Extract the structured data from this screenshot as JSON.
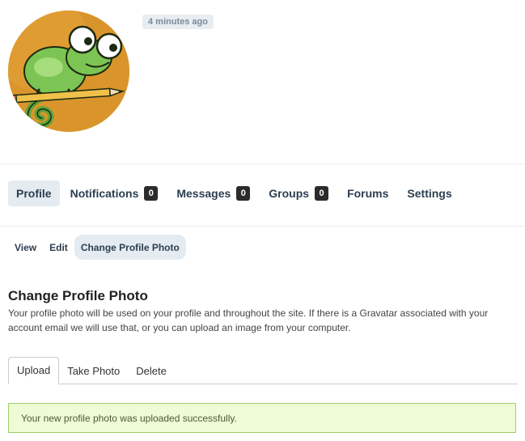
{
  "profile": {
    "timestamp": "4 minutes ago"
  },
  "main_nav": {
    "items": [
      {
        "label": "Profile",
        "count": null,
        "active": true
      },
      {
        "label": "Notifications",
        "count": "0",
        "active": false
      },
      {
        "label": "Messages",
        "count": "0",
        "active": false
      },
      {
        "label": "Groups",
        "count": "0",
        "active": false
      },
      {
        "label": "Forums",
        "count": null,
        "active": false
      },
      {
        "label": "Settings",
        "count": null,
        "active": false
      }
    ]
  },
  "sub_nav": {
    "items": [
      {
        "label": "View",
        "active": false
      },
      {
        "label": "Edit",
        "active": false
      },
      {
        "label": "Change Profile Photo",
        "active": true
      }
    ]
  },
  "section": {
    "title": "Change Profile Photo",
    "description": "Your profile photo will be used on your profile and throughout the site. If there is a Gravatar associated with your account email we will use that, or you can upload an image from your computer."
  },
  "tabs": {
    "items": [
      {
        "label": "Upload",
        "active": true
      },
      {
        "label": "Take Photo",
        "active": false
      },
      {
        "label": "Delete",
        "active": false
      }
    ]
  },
  "alert": {
    "message": "Your new profile photo was uploaded successfully."
  },
  "colors": {
    "accent_bg": "#e4ebf1",
    "nav_text": "#2b3e50",
    "success_bg": "#eefbd4",
    "success_border": "#9fcf6a",
    "avatar_bg": "#d9952b"
  }
}
